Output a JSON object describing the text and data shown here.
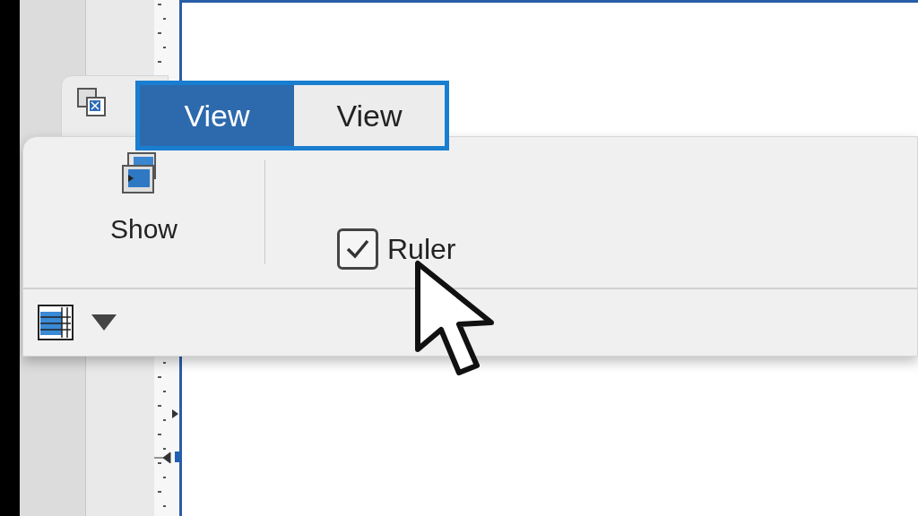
{
  "tabs": [
    {
      "label": "View",
      "selected": true
    },
    {
      "label": "View",
      "selected": false
    }
  ],
  "show_button": {
    "label": "Show"
  },
  "ruler_checkbox": {
    "label": "Ruler",
    "checked": true
  }
}
